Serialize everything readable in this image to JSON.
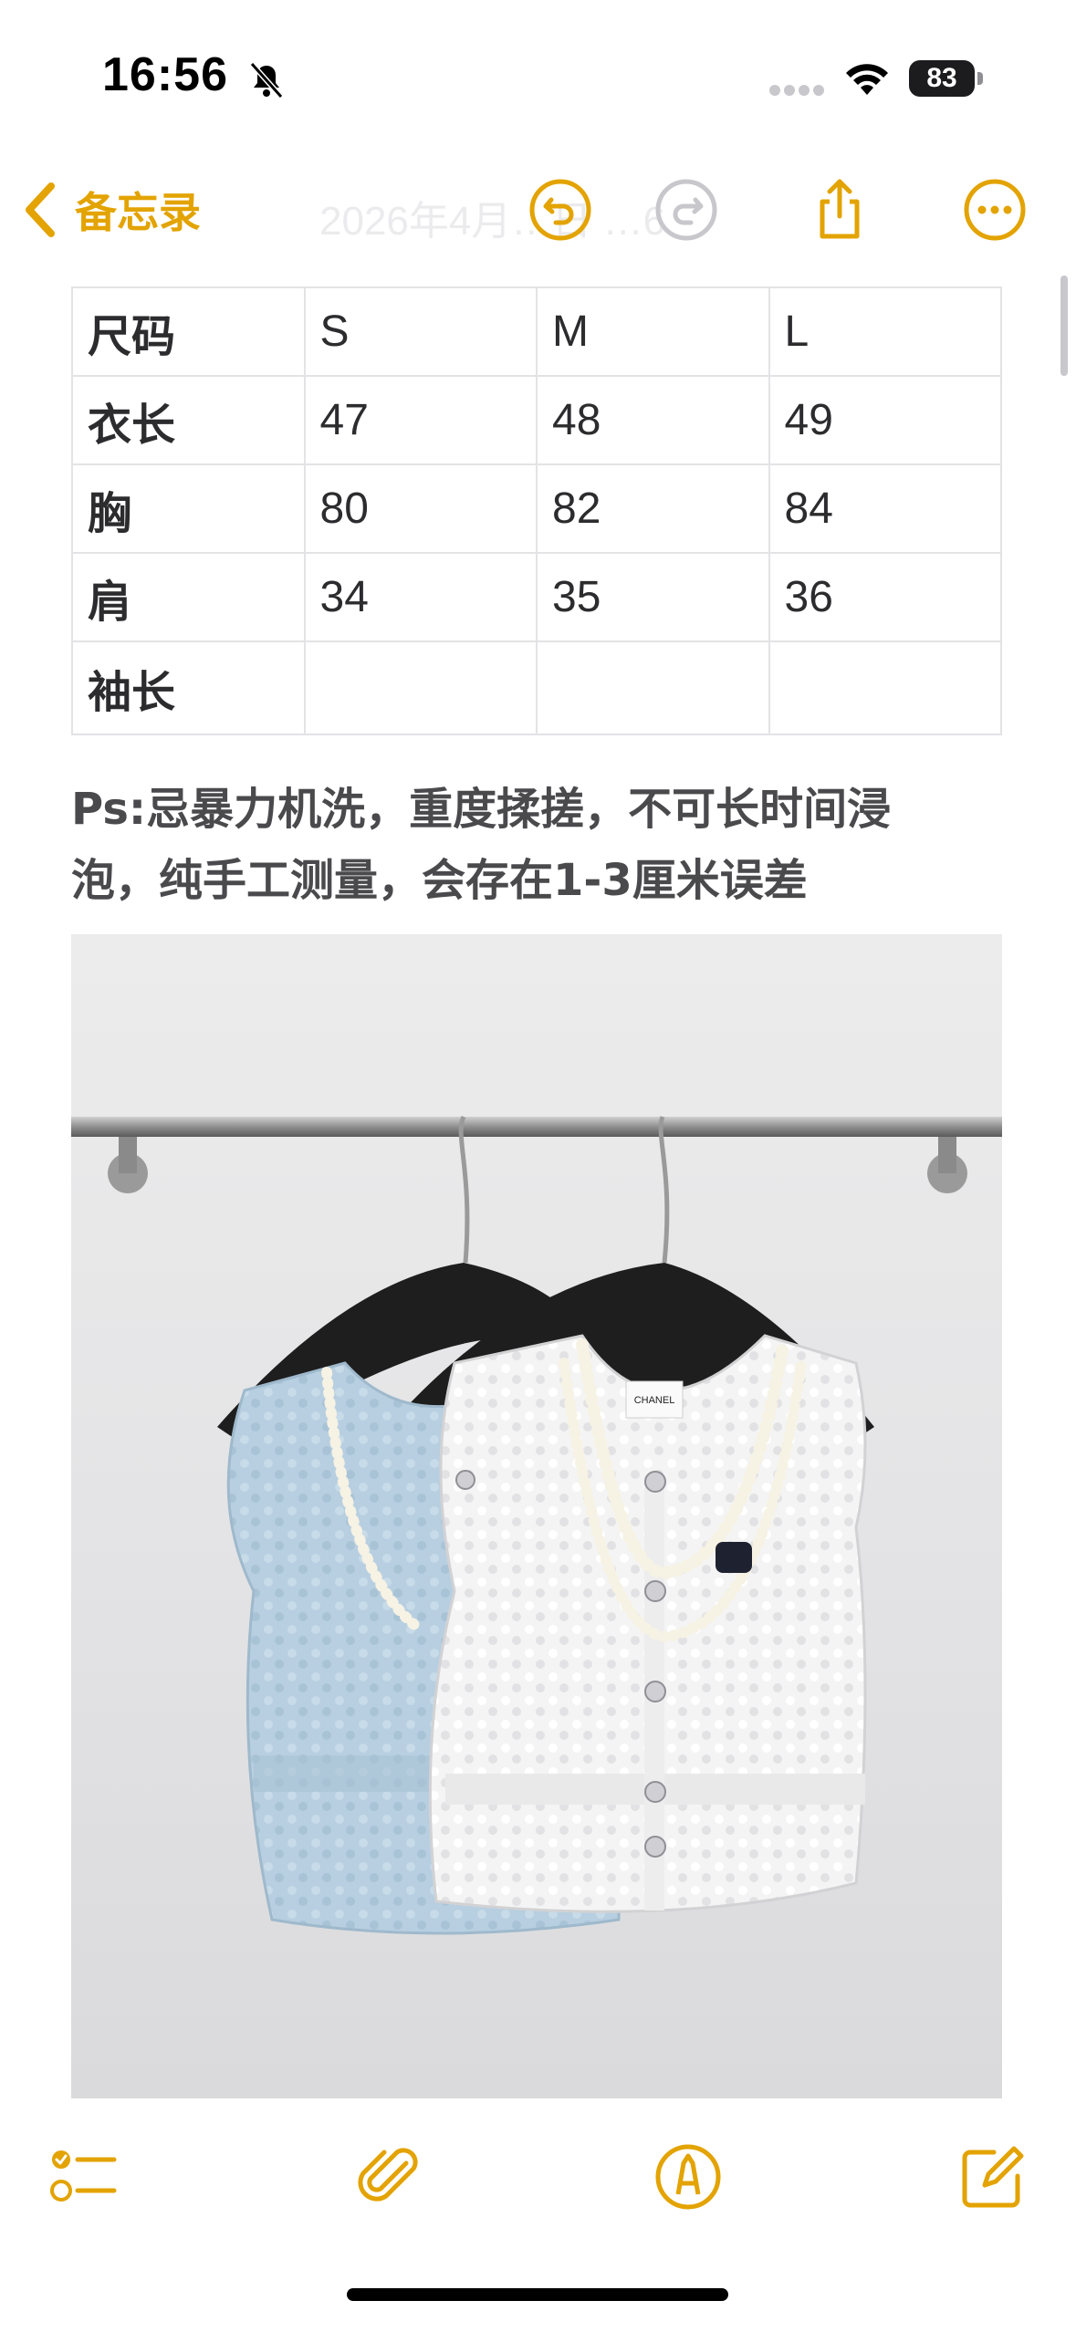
{
  "status_bar": {
    "time": "16:56",
    "battery_level": "83",
    "icons": [
      "bell-slash-icon",
      "signal-icon",
      "wifi-icon",
      "battery-icon"
    ]
  },
  "nav": {
    "back_label": "备忘录",
    "title_ghost": "2026年4月…日 …6",
    "icons": [
      "chevron-left-icon",
      "undo-icon",
      "redo-icon",
      "share-icon",
      "ellipsis-circle-icon"
    ],
    "accent_color": "#e3a300"
  },
  "size_table": {
    "columns": [
      "尺码",
      "S",
      "M",
      "L"
    ],
    "rows": [
      {
        "label": "衣长",
        "values": [
          "47",
          "48",
          "49"
        ]
      },
      {
        "label": "胸",
        "values": [
          "80",
          "82",
          "84"
        ]
      },
      {
        "label": "肩",
        "values": [
          "34",
          "35",
          "36"
        ]
      },
      {
        "label": "袖长",
        "values": [
          "",
          "",
          ""
        ]
      }
    ]
  },
  "note": {
    "line1": "Ps:忌暴力机洗，重度揉搓，不可长时间浸",
    "line2": "泡，纯手工测量，会存在1-3厘米误差"
  },
  "photo": {
    "label_text": "CHANEL",
    "subject": "two sleeveless knit tops on hangers"
  },
  "toolbar": {
    "icons": [
      "checklist-icon",
      "paperclip-icon",
      "markup-pen-icon",
      "compose-icon"
    ]
  }
}
